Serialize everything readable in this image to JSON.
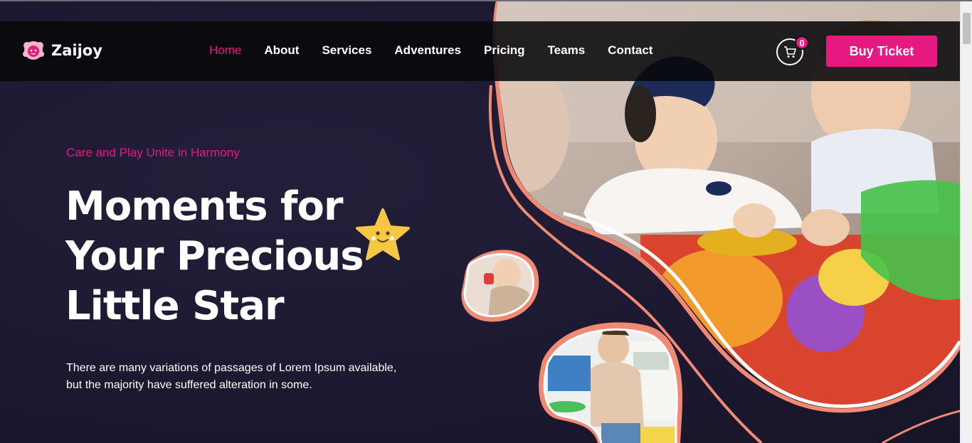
{
  "brand": {
    "name": "Zaijoy"
  },
  "nav": {
    "items": [
      {
        "label": "Home",
        "active": true
      },
      {
        "label": "About",
        "active": false
      },
      {
        "label": "Services",
        "active": false
      },
      {
        "label": "Adventures",
        "active": false
      },
      {
        "label": "Pricing",
        "active": false
      },
      {
        "label": "Teams",
        "active": false
      },
      {
        "label": "Contact",
        "active": false
      }
    ]
  },
  "cart": {
    "count": "0",
    "icon": "cart-icon"
  },
  "cta": {
    "label": "Buy Ticket"
  },
  "hero": {
    "tagline": "Care and Play Unite in Harmony",
    "headline": [
      "Moments for",
      "Your Precious",
      "Little Star"
    ],
    "description": [
      "There are many variations of passages of Lorem Ipsum available,",
      "but the majority have suffered alteration in some."
    ]
  },
  "colors": {
    "accent": "#e5197f",
    "background": "#1c1830",
    "coral": "#f08a74",
    "star": "#f6c744"
  }
}
